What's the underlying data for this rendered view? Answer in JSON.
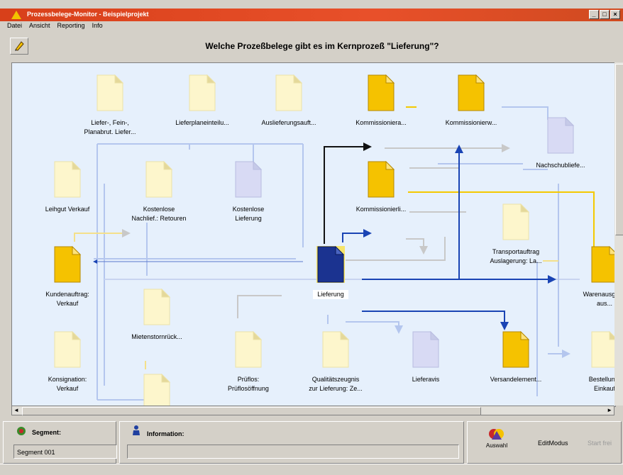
{
  "window": {
    "title": "Prozessbelege-Monitor - Beispielprojekt",
    "controls": [
      "_",
      "□",
      "×"
    ]
  },
  "menu": [
    "Datei",
    "Ansicht",
    "Reporting",
    "Info"
  ],
  "header": {
    "question": "Welche Prozeßbelege gibt es im Kernprozeß \"Lieferung\"?"
  },
  "colors": {
    "gold": "#f5c200",
    "pale": "#fdf6cc",
    "lav": "#d8daf4",
    "navy": "#1b3390",
    "line_blue": "#1a44b4",
    "line_gray": "#c8c8c8",
    "line_light": "#b4c6ee",
    "line_yellow": "#f4c900"
  },
  "nodes": [
    {
      "id": "n1",
      "style": "pale",
      "label": "Liefer-, Fein-,\nPlanabrut. Liefer..."
    },
    {
      "id": "n2",
      "style": "pale",
      "label": "Lieferplaneinteilu..."
    },
    {
      "id": "n3",
      "style": "pale",
      "label": "Auslieferungsauft..."
    },
    {
      "id": "n4",
      "style": "gold",
      "label": "Kommissioniera..."
    },
    {
      "id": "n5",
      "style": "gold",
      "label": "Kommissionierw..."
    },
    {
      "id": "n6",
      "style": "lav",
      "label": "Nachschubliefe..."
    },
    {
      "id": "n7",
      "style": "pale",
      "label": "Leihgut Verkauf"
    },
    {
      "id": "n8",
      "style": "pale",
      "label": "Kostenlose\nNachlief.: Retouren"
    },
    {
      "id": "n9",
      "style": "lav",
      "label": "Kostenlose\nLieferung"
    },
    {
      "id": "n10",
      "style": "gold",
      "label": "Kommissionierli..."
    },
    {
      "id": "n11",
      "style": "pale",
      "label": "Transportauftrag\nAuslagerung: La..."
    },
    {
      "id": "n12",
      "style": "gold",
      "label": "Kundenauftrag:\nVerkauf"
    },
    {
      "id": "n13",
      "style": "navy",
      "label": "Lieferung"
    },
    {
      "id": "n14",
      "style": "gold",
      "label": "Warenausgang\naus..."
    },
    {
      "id": "n15",
      "style": "pale",
      "label": "Mietenstornrück..."
    },
    {
      "id": "n16",
      "style": "pale",
      "label": "Konsignation:\nVerkauf"
    },
    {
      "id": "n17",
      "style": "pale",
      "label": "Prüflos:\nPrüflosöffnung"
    },
    {
      "id": "n18",
      "style": "pale",
      "label": "Qualitätszeugnis\nzur Lieferung: Ze..."
    },
    {
      "id": "n19",
      "style": "lav",
      "label": "Lieferavis"
    },
    {
      "id": "n20",
      "style": "gold",
      "label": "Versandelement..."
    },
    {
      "id": "n21",
      "style": "pale",
      "label": "Bestellung:\nEinkauf"
    },
    {
      "id": "n22",
      "style": "pale",
      "label": ""
    }
  ],
  "status": {
    "segment_caption": "Segment:",
    "segment_value": "Segment 001",
    "info_caption": "Information:",
    "info_value": "",
    "auswahl_label": "Auswahl",
    "editmode_label": "EditModus",
    "start_label": "Start frei"
  },
  "scroll": {
    "arrow_left": "◄",
    "arrow_right": "►"
  }
}
